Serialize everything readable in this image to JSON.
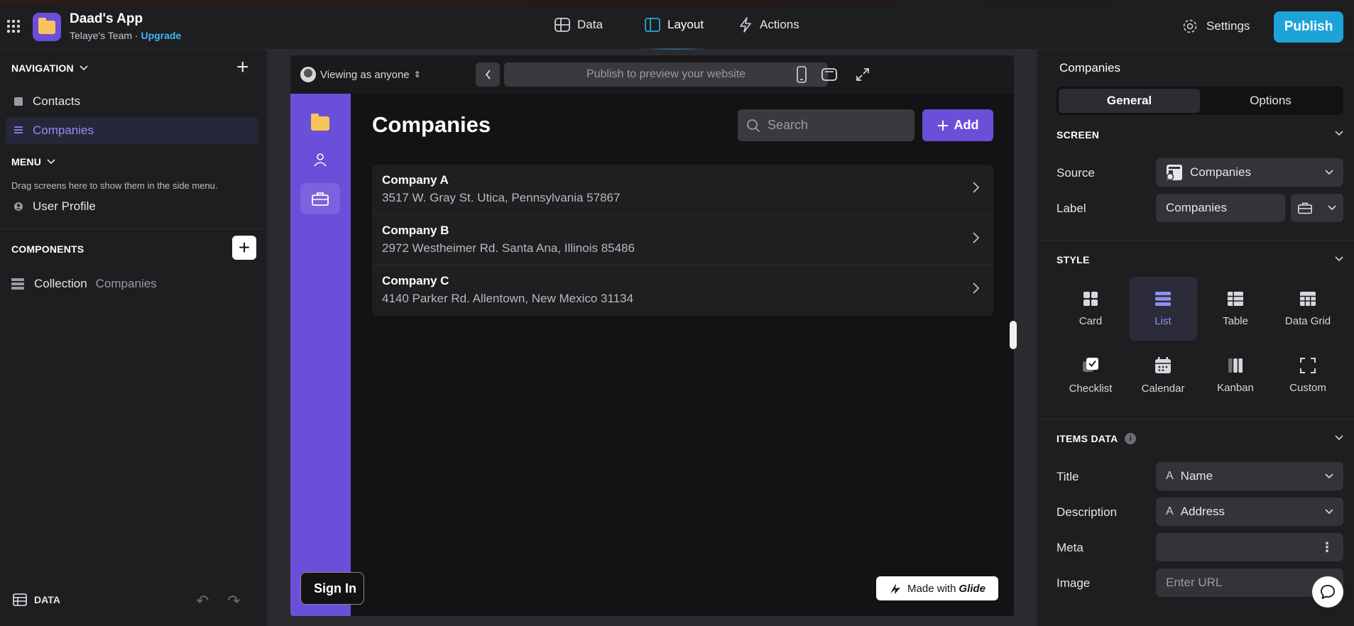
{
  "app": {
    "name": "Daad's App",
    "team": "Telaye's Team",
    "separator": "·",
    "upgrade": "Upgrade"
  },
  "topnav": {
    "data": "Data",
    "layout": "Layout",
    "actions": "Actions",
    "settings": "Settings",
    "publish": "Publish"
  },
  "left": {
    "navigation_title": "NAVIGATION",
    "nav_items": [
      {
        "label": "Contacts"
      },
      {
        "label": "Companies"
      }
    ],
    "menu_title": "MENU",
    "menu_hint": "Drag screens here to show them in the side menu.",
    "menu_items": [
      {
        "label": "User Profile"
      }
    ],
    "components_title": "COMPONENTS",
    "collection_label": "Collection",
    "collection_source": "Companies",
    "data_label": "DATA"
  },
  "preview": {
    "viewing": "Viewing as anyone",
    "url_placeholder": "Publish to preview your website",
    "page_title": "Companies",
    "search_placeholder": "Search",
    "add_label": "Add",
    "signin": "Sign In",
    "items": [
      {
        "title": "Company A",
        "address": "3517 W. Gray St. Utica, Pennsylvania 57867"
      },
      {
        "title": "Company B",
        "address": "2972 Westheimer Rd. Santa Ana, Illinois 85486"
      },
      {
        "title": "Company C",
        "address": "4140 Parker Rd. Allentown, New Mexico 31134"
      }
    ],
    "made_with": "Made with",
    "brand": "Glide"
  },
  "right": {
    "title": "Companies",
    "tabs": {
      "general": "General",
      "options": "Options"
    },
    "screen_section": "SCREEN",
    "source_label": "Source",
    "source_value": "Companies",
    "label_label": "Label",
    "label_value": "Companies",
    "style_section": "STYLE",
    "styles": [
      "Card",
      "List",
      "Table",
      "Data Grid",
      "Checklist",
      "Calendar",
      "Kanban",
      "Custom"
    ],
    "selected_style": "List",
    "items_section": "ITEMS DATA",
    "title_label": "Title",
    "title_value": "Name",
    "description_label": "Description",
    "description_value": "Address",
    "meta_label": "Meta",
    "image_label": "Image",
    "image_placeholder": "Enter URL"
  },
  "colors": {
    "accent": "#6a4fd9",
    "publish": "#1ea3d9",
    "selected_text": "#8f8ff2"
  }
}
